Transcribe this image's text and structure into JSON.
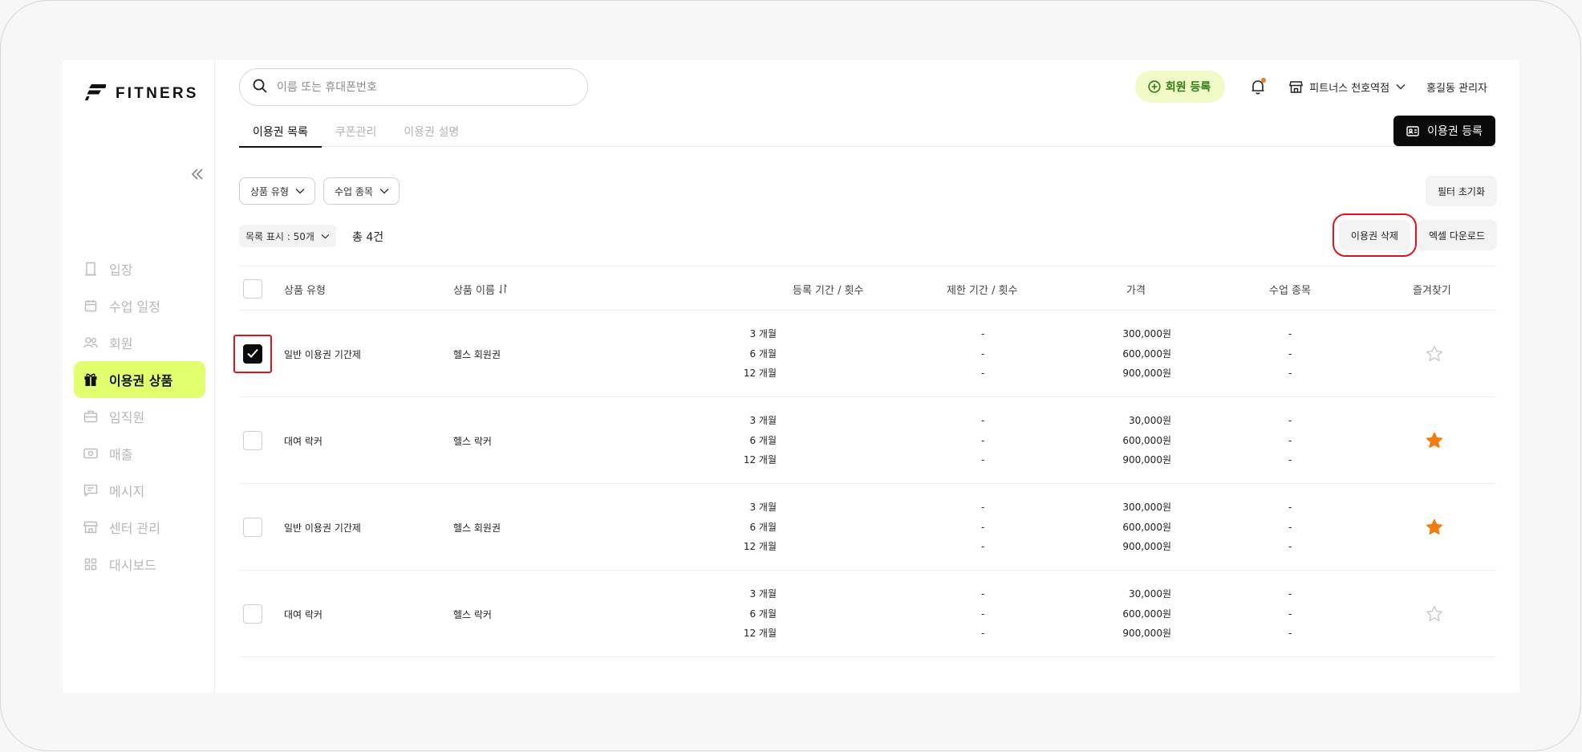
{
  "brand": {
    "name": "FITNERS"
  },
  "sidebar": {
    "items": [
      {
        "label": "입장",
        "icon": "door-icon",
        "active": false
      },
      {
        "label": "수업 일정",
        "icon": "calendar-icon",
        "active": false
      },
      {
        "label": "회원",
        "icon": "members-icon",
        "active": false
      },
      {
        "label": "이용권 상품",
        "icon": "gift-icon",
        "active": true
      },
      {
        "label": "임직원",
        "icon": "briefcase-icon",
        "active": false
      },
      {
        "label": "매출",
        "icon": "money-icon",
        "active": false
      },
      {
        "label": "메시지",
        "icon": "message-icon",
        "active": false
      },
      {
        "label": "센터 관리",
        "icon": "store-icon",
        "active": false
      },
      {
        "label": "대시보드",
        "icon": "dashboard-icon",
        "active": false
      }
    ]
  },
  "header": {
    "search_placeholder": "이름 또는 휴대폰번호",
    "member_register_label": "회원 등록",
    "center_name": "피트너스 천호역점",
    "admin_name": "홍길동 관리자"
  },
  "tabs": [
    {
      "label": "이용권 목록",
      "active": true
    },
    {
      "label": "쿠폰관리",
      "active": false
    },
    {
      "label": "이용권 설명",
      "active": false
    }
  ],
  "toolbar": {
    "register_label": "이용권 등록",
    "filter_type_label": "상품 유형",
    "filter_class_label": "수업 종목",
    "reset_label": "필터 초기화",
    "list_display_label": "목록 표시 : 50개",
    "total_label": "총 4건",
    "delete_label": "이용권 삭제",
    "excel_label": "엑셀 다운로드"
  },
  "table": {
    "headers": {
      "type": "상품 유형",
      "name": "상품 이름",
      "period": "등록 기간 / 횟수",
      "limit": "제한 기간 / 횟수",
      "price": "가격",
      "class": "수업 종목",
      "favorite": "즐겨찾기"
    },
    "rows": [
      {
        "checked": true,
        "type": "일반 이용권 기간제",
        "name": "헬스 회원권",
        "periods": [
          "3 개월",
          "6 개월",
          "12 개월"
        ],
        "limits": [
          "-",
          "-",
          "-"
        ],
        "prices": [
          "300,000원",
          "600,000원",
          "900,000원"
        ],
        "classes": [
          "-",
          "-",
          "-"
        ],
        "favorite": false
      },
      {
        "checked": false,
        "type": "대여 락커",
        "name": "헬스 락커",
        "periods": [
          "3 개월",
          "6 개월",
          "12 개월"
        ],
        "limits": [
          "-",
          "-",
          "-"
        ],
        "prices": [
          "30,000원",
          "600,000원",
          "900,000원"
        ],
        "classes": [
          "-",
          "-",
          "-"
        ],
        "favorite": true
      },
      {
        "checked": false,
        "type": "일반 이용권 기간제",
        "name": "헬스 회원권",
        "periods": [
          "3 개월",
          "6 개월",
          "12 개월"
        ],
        "limits": [
          "-",
          "-",
          "-"
        ],
        "prices": [
          "300,000원",
          "600,000원",
          "900,000원"
        ],
        "classes": [
          "-",
          "-",
          "-"
        ],
        "favorite": true
      },
      {
        "checked": false,
        "type": "대여 락커",
        "name": "헬스 락커",
        "periods": [
          "3 개월",
          "6 개월",
          "12 개월"
        ],
        "limits": [
          "-",
          "-",
          "-"
        ],
        "prices": [
          "30,000원",
          "600,000원",
          "900,000원"
        ],
        "classes": [
          "-",
          "-",
          "-"
        ],
        "favorite": false
      }
    ]
  },
  "colors": {
    "accent": "#e2ff6e",
    "favorite": "#f47b0f",
    "highlight": "#e2141b",
    "member_button_bg": "#f0fbc7",
    "member_button_text": "#2f7a12"
  }
}
